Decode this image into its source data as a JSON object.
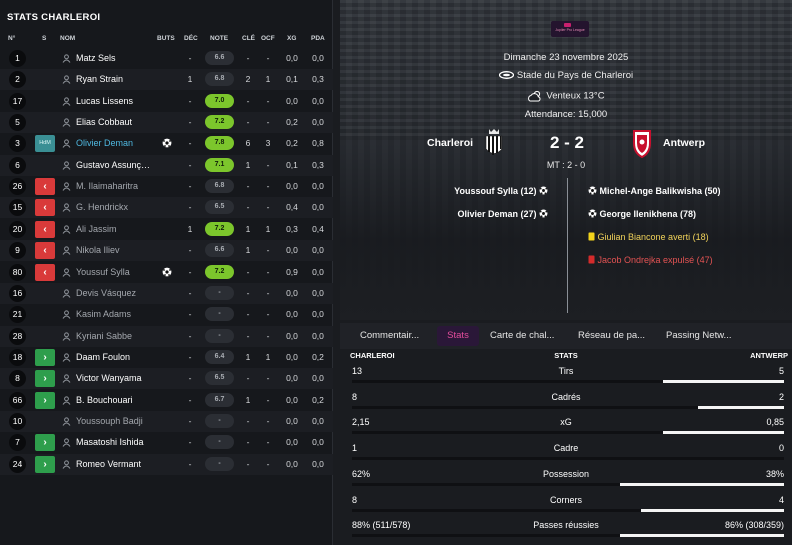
{
  "left_panel": {
    "title": "STATS CHARLEROI",
    "headers": {
      "num": "N°",
      "s": "S",
      "name": "NOM",
      "goals": "BUTS",
      "dec": "DÉC",
      "rating": "NOTE",
      "key": "CLÉ",
      "ocf": "OCF",
      "xg": "XG",
      "pda": "PDA"
    },
    "players": [
      {
        "num": "1",
        "sub": "",
        "name": "Matz Sels",
        "goal": false,
        "dec": "-",
        "rating": "6.6",
        "good": false,
        "key": "-",
        "ocf": "-",
        "xg": "0,0",
        "pda": "0,0",
        "dim": false,
        "hl": false
      },
      {
        "num": "2",
        "sub": "",
        "name": "Ryan Strain",
        "goal": false,
        "dec": "1",
        "rating": "6.8",
        "good": false,
        "key": "2",
        "ocf": "1",
        "xg": "0,1",
        "pda": "0,3",
        "dim": false,
        "hl": false
      },
      {
        "num": "17",
        "sub": "",
        "name": "Lucas Lissens",
        "goal": false,
        "dec": "-",
        "rating": "7.0",
        "good": true,
        "key": "-",
        "ocf": "-",
        "xg": "0,0",
        "pda": "0,0",
        "dim": false,
        "hl": false
      },
      {
        "num": "5",
        "sub": "",
        "name": "Elias Cobbaut",
        "goal": false,
        "dec": "-",
        "rating": "7.2",
        "good": true,
        "key": "-",
        "ocf": "-",
        "xg": "0,2",
        "pda": "0,0",
        "dim": false,
        "hl": false
      },
      {
        "num": "3",
        "sub": "HdM",
        "name": "Olivier Deman",
        "goal": true,
        "dec": "-",
        "rating": "7.8",
        "good": true,
        "key": "6",
        "ocf": "3",
        "xg": "0,2",
        "pda": "0,8",
        "dim": false,
        "hl": true
      },
      {
        "num": "6",
        "sub": "",
        "name": "Gustavo Assunç…",
        "goal": false,
        "dec": "-",
        "rating": "7.1",
        "good": true,
        "key": "1",
        "ocf": "-",
        "xg": "0,1",
        "pda": "0,3",
        "dim": false,
        "hl": false
      },
      {
        "num": "26",
        "sub": "out",
        "name": "M. Ilaimaharitra",
        "goal": false,
        "dec": "-",
        "rating": "6.8",
        "good": false,
        "key": "-",
        "ocf": "-",
        "xg": "0,0",
        "pda": "0,0",
        "dim": true,
        "hl": false
      },
      {
        "num": "15",
        "sub": "out",
        "name": "G. Hendrickx",
        "goal": false,
        "dec": "-",
        "rating": "6.5",
        "good": false,
        "key": "-",
        "ocf": "-",
        "xg": "0,4",
        "pda": "0,0",
        "dim": true,
        "hl": false
      },
      {
        "num": "20",
        "sub": "out",
        "name": "Ali Jassim",
        "goal": false,
        "dec": "1",
        "rating": "7.2",
        "good": true,
        "key": "1",
        "ocf": "1",
        "xg": "0,3",
        "pda": "0,4",
        "dim": true,
        "hl": false
      },
      {
        "num": "9",
        "sub": "out",
        "name": "Nikola Iliev",
        "goal": false,
        "dec": "-",
        "rating": "6.6",
        "good": false,
        "key": "1",
        "ocf": "-",
        "xg": "0,0",
        "pda": "0,0",
        "dim": true,
        "hl": false
      },
      {
        "num": "80",
        "sub": "out",
        "name": "Youssuf Sylla",
        "goal": true,
        "dec": "-",
        "rating": "7.2",
        "good": true,
        "key": "-",
        "ocf": "-",
        "xg": "0,9",
        "pda": "0,0",
        "dim": true,
        "hl": false
      },
      {
        "num": "16",
        "sub": "",
        "name": "Devis Vásquez",
        "goal": false,
        "dec": "-",
        "rating": "-",
        "good": false,
        "key": "-",
        "ocf": "-",
        "xg": "0,0",
        "pda": "0,0",
        "dim": true,
        "hl": false
      },
      {
        "num": "21",
        "sub": "",
        "name": "Kasim Adams",
        "goal": false,
        "dec": "-",
        "rating": "-",
        "good": false,
        "key": "-",
        "ocf": "-",
        "xg": "0,0",
        "pda": "0,0",
        "dim": true,
        "hl": false
      },
      {
        "num": "28",
        "sub": "",
        "name": "Kyriani Sabbe",
        "goal": false,
        "dec": "-",
        "rating": "-",
        "good": false,
        "key": "-",
        "ocf": "-",
        "xg": "0,0",
        "pda": "0,0",
        "dim": true,
        "hl": false
      },
      {
        "num": "18",
        "sub": "in",
        "name": "Daam Foulon",
        "goal": false,
        "dec": "-",
        "rating": "6.4",
        "good": false,
        "key": "1",
        "ocf": "1",
        "xg": "0,0",
        "pda": "0,2",
        "dim": false,
        "hl": false
      },
      {
        "num": "8",
        "sub": "in",
        "name": "Victor Wanyama",
        "goal": false,
        "dec": "-",
        "rating": "6.5",
        "good": false,
        "key": "-",
        "ocf": "-",
        "xg": "0,0",
        "pda": "0,0",
        "dim": false,
        "hl": false
      },
      {
        "num": "66",
        "sub": "in",
        "name": "B. Bouchouari",
        "goal": false,
        "dec": "-",
        "rating": "6.7",
        "good": false,
        "key": "1",
        "ocf": "-",
        "xg": "0,0",
        "pda": "0,2",
        "dim": false,
        "hl": false
      },
      {
        "num": "10",
        "sub": "",
        "name": "Youssouph Badji",
        "goal": false,
        "dec": "-",
        "rating": "-",
        "good": false,
        "key": "-",
        "ocf": "-",
        "xg": "0,0",
        "pda": "0,0",
        "dim": true,
        "hl": false
      },
      {
        "num": "7",
        "sub": "in",
        "name": "Masatoshi Ishida",
        "goal": false,
        "dec": "-",
        "rating": "-",
        "good": false,
        "key": "-",
        "ocf": "-",
        "xg": "0,0",
        "pda": "0,0",
        "dim": false,
        "hl": false
      },
      {
        "num": "24",
        "sub": "in",
        "name": "Romeo Vermant",
        "goal": false,
        "dec": "-",
        "rating": "-",
        "good": false,
        "key": "-",
        "ocf": "-",
        "xg": "0,0",
        "pda": "0,0",
        "dim": false,
        "hl": false
      }
    ]
  },
  "match": {
    "date": "Dimanche 23 novembre 2025",
    "stadium": "Stade du Pays de Charleroi",
    "weather": "Venteux 13°C",
    "attendance": "Attendance: 15,000",
    "home_team": "Charleroi",
    "away_team": "Antwerp",
    "score": "2 - 2",
    "half_time": "MT : 2 - 0",
    "league_logo_text": "Jupiler Pro League",
    "home_events": [
      "Youssouf Sylla (12)",
      "Olivier Deman (27)"
    ],
    "away_events": [
      {
        "text": "Michel-Ange Balikwisha (50)",
        "type": "goal"
      },
      {
        "text": "George Ilenikhena (78)",
        "type": "goal"
      },
      {
        "text": "Giulian Biancone averti (18)",
        "type": "yellow"
      },
      {
        "text": "Jacob Ondrejka expulsé (47)",
        "type": "red"
      }
    ]
  },
  "tabs": [
    "Commentair...",
    "Stats",
    "Carte de chal...",
    "Réseau de pa...",
    "Passing Netw..."
  ],
  "active_tab": 1,
  "stats": {
    "home_label": "CHARLEROI",
    "title": "STATS",
    "away_label": "ANTWERP",
    "rows": [
      {
        "label": "Tirs",
        "home": "13",
        "away": "5",
        "home_share": 0.72
      },
      {
        "label": "Cadrés",
        "home": "8",
        "away": "2",
        "home_share": 0.8
      },
      {
        "label": "xG",
        "home": "2,15",
        "away": "0,85",
        "home_share": 0.72
      },
      {
        "label": "Cadre",
        "home": "1",
        "away": "0",
        "home_share": 1.0
      },
      {
        "label": "Possession",
        "home": "62%",
        "away": "38%",
        "home_share": 0.62
      },
      {
        "label": "Corners",
        "home": "8",
        "away": "4",
        "home_share": 0.67
      },
      {
        "label": "Passes réussies",
        "home": "88% (511/578)",
        "away": "86% (308/359)",
        "home_share": 0.62
      }
    ]
  },
  "colors": {
    "accent": "#e34d9c",
    "rating_good": "#7cc62c",
    "sub_in": "#2e9e4c",
    "sub_out": "#d93a3a",
    "highlight": "#4fb8e0",
    "yellow_card": "#f0d25a",
    "red_card": "#e35353"
  }
}
